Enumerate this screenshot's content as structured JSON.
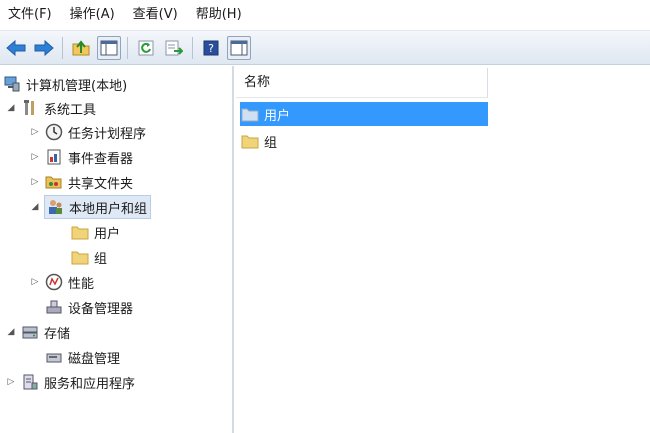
{
  "menu": [
    "文件(F)",
    "操作(A)",
    "查看(V)",
    "帮助(H)"
  ],
  "toolbar": {
    "icons": [
      "back-arrow-icon",
      "forward-arrow-icon",
      "up-folder-icon",
      "show-hide-tree-icon",
      "refresh-icon",
      "export-list-icon",
      "help-icon",
      "show-hide-action-pane-icon"
    ]
  },
  "tree": {
    "root": "计算机管理(本地)",
    "system_tools": "系统工具",
    "task_scheduler": "任务计划程序",
    "event_viewer": "事件查看器",
    "shared_folders": "共享文件夹",
    "local_users_groups": "本地用户和组",
    "users": "用户",
    "groups": "组",
    "performance": "性能",
    "device_manager": "设备管理器",
    "storage": "存储",
    "disk_management": "磁盘管理",
    "services_apps": "服务和应用程序"
  },
  "list": {
    "column_name": "名称",
    "items": [
      "用户",
      "组"
    ]
  },
  "colors": {
    "selection": "#3399ff",
    "folder": "#f1d37a"
  }
}
